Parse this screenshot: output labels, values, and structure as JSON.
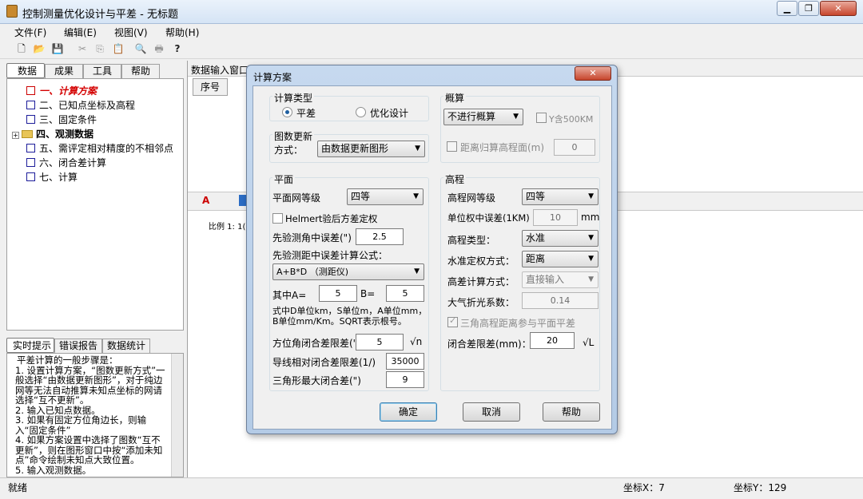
{
  "window": {
    "title": "控制测量优化设计与平差 - 无标题"
  },
  "menu": [
    "文件(F)",
    "编辑(E)",
    "视图(V)",
    "帮助(H)"
  ],
  "left_tabs": [
    "数据",
    "成果",
    "工具",
    "帮助"
  ],
  "tree": [
    {
      "label": "一、计算方案",
      "style": "active"
    },
    {
      "label": "二、已知点坐标及高程",
      "style": "normal"
    },
    {
      "label": "三、固定条件",
      "style": "normal"
    },
    {
      "label": "四、观测数据",
      "style": "folder"
    },
    {
      "label": "五、需评定相对精度的不相邻点",
      "style": "normal"
    },
    {
      "label": "六、闭合差计算",
      "style": "normal"
    },
    {
      "label": "七、计算",
      "style": "normal"
    }
  ],
  "bottom_tabs": [
    "实时提示",
    "错误报告",
    "数据统计"
  ],
  "hint_lines": [
    "平差计算的一般步骤是：",
    "1. 设置计算方案，“图数更新方式”一般选择“由数据更新图形”，对于纯边网等无法自动推算未知点坐标的网请选择“互不更新”。",
    "2. 输入已知点数据。",
    "3. 如果有固定方位角边长，则输入“固定条件”",
    "4. 如果方案设置中选择了图数“互不更新”，则在图形窗口中按“添加未知点”命令绘制未知点大致位置。",
    "5. 输入观测数据。"
  ],
  "right": {
    "title": "数据输入窗口",
    "col1": "序号",
    "scale": "比例 1: 1("
  },
  "status": {
    "ready": "就绪",
    "x": "坐标X：7",
    "y": "坐标Y：129"
  },
  "dialog": {
    "title": "计算方案",
    "calc_type": {
      "label": "计算类型",
      "opt1": "平差",
      "opt2": "优化设计"
    },
    "graph_update": {
      "label": "图数更新",
      "mode_label": "方式：",
      "mode": "由数据更新图形"
    },
    "summary": {
      "label": "概算",
      "select": "不进行概算",
      "y500": "Y含500KM",
      "dist_label": "距离归算高程面(m)",
      "dist": "0"
    },
    "plane": {
      "label": "平面",
      "grade_label": "平面网等级",
      "grade": "四等",
      "helmert": "Helmert验后方差定权",
      "angle_err_label": "先验测角中误差(\")",
      "angle_err": "2.5",
      "dist_formula_label": "先验测距中误差计算公式：",
      "dist_formula": "A+B*D （测距仪)",
      "a_label": "其中A=",
      "a": "5",
      "b_label": "B=",
      "b": "5",
      "note": "式中D单位km，S单位m，A单位mm，B单位mm/Km。SQRT表示根号。",
      "az_label": "方位角闭合差限差(\")",
      "az": "5",
      "az_unit": "√n",
      "trav_label": "导线相对闭合差限差(1/)",
      "trav": "35000",
      "tri_label": "三角形最大闭合差(\")",
      "tri": "9"
    },
    "height": {
      "label": "高程",
      "grade_label": "高程网等级",
      "grade": "四等",
      "unit_err_label": "单位权中误差(1KM)",
      "unit_err": "10",
      "unit_err_unit": "mm",
      "type_label": "高程类型：",
      "type": "水准",
      "weight_label": "水准定权方式：",
      "weight": "距离",
      "diff_label": "高差计算方式：",
      "diff": "直接输入",
      "refr_label": "大气折光系数：",
      "refr": "0.14",
      "tri_join": "三角高程距离参与平面平差",
      "close_label": "闭合差限差(mm)：",
      "close": "20",
      "close_unit": "√L"
    },
    "buttons": {
      "ok": "确定",
      "cancel": "取消",
      "help": "帮助"
    }
  }
}
